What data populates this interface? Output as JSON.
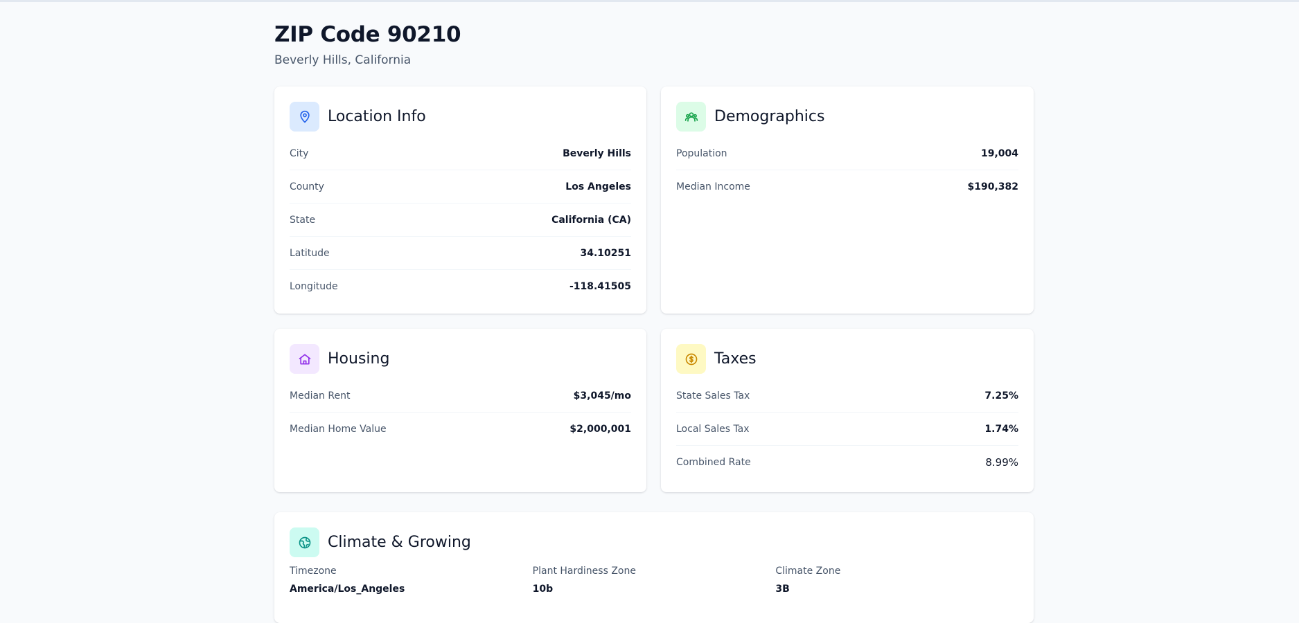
{
  "header": {
    "title": "ZIP Code 90210",
    "subtitle": "Beverly Hills, California"
  },
  "location": {
    "title": "Location Info",
    "icon": "map-pin-icon",
    "rows": [
      {
        "label": "City",
        "value": "Beverly Hills"
      },
      {
        "label": "County",
        "value": "Los Angeles"
      },
      {
        "label": "State",
        "value": "California (CA)"
      },
      {
        "label": "Latitude",
        "value": "34.10251"
      },
      {
        "label": "Longitude",
        "value": "-118.41505"
      }
    ]
  },
  "demographics": {
    "title": "Demographics",
    "icon": "users-icon",
    "rows": [
      {
        "label": "Population",
        "value": "19,004"
      },
      {
        "label": "Median Income",
        "value": "$190,382"
      }
    ]
  },
  "housing": {
    "title": "Housing",
    "icon": "home-icon",
    "rows": [
      {
        "label": "Median Rent",
        "value": "$3,045/mo"
      },
      {
        "label": "Median Home Value",
        "value": "$2,000,001"
      }
    ]
  },
  "taxes": {
    "title": "Taxes",
    "icon": "dollar-coin-icon",
    "rows": [
      {
        "label": "State Sales Tax",
        "value": "7.25%"
      },
      {
        "label": "Local Sales Tax",
        "value": "1.74%"
      },
      {
        "label": "Combined Rate",
        "value": "8.99%"
      }
    ]
  },
  "climate": {
    "title": "Climate & Growing",
    "icon": "globe-icon",
    "items": [
      {
        "label": "Timezone",
        "value": "America/Los_Angeles"
      },
      {
        "label": "Plant Hardiness Zone",
        "value": "10b"
      },
      {
        "label": "Climate Zone",
        "value": "3B"
      }
    ]
  },
  "colors": {
    "background": "#f8fafc",
    "location_icon_bg": "#dbeafe",
    "location_icon": "#2563eb",
    "demographics_icon_bg": "#dcfce7",
    "demographics_icon": "#16a34a",
    "housing_icon_bg": "#f3e8ff",
    "housing_icon": "#9333ea",
    "taxes_icon_bg": "#fef9c3",
    "taxes_icon": "#ca8a04",
    "climate_icon_bg": "#ccfbf1",
    "climate_icon": "#0d9488"
  }
}
